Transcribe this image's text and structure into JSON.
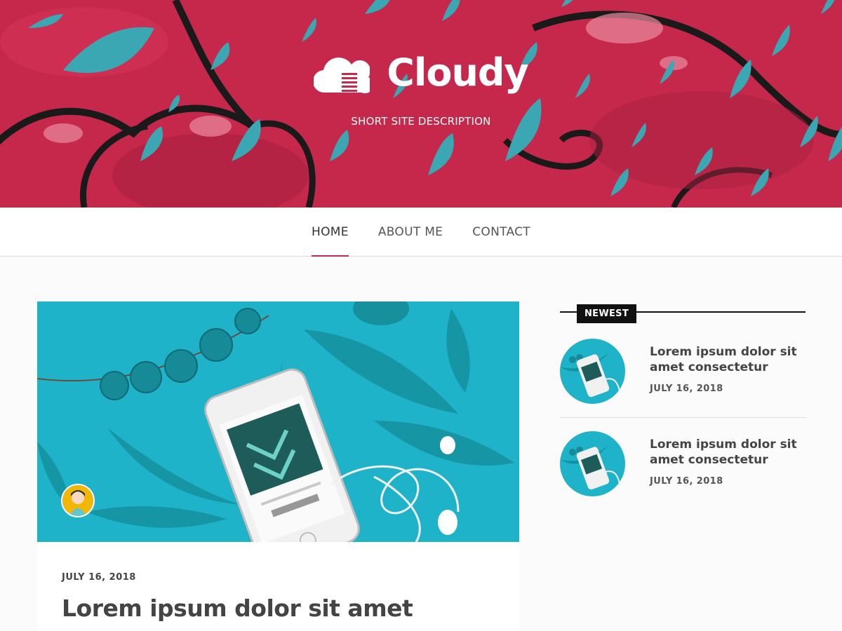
{
  "site": {
    "title": "Cloudy",
    "tagline": "SHORT SITE DESCRIPTION"
  },
  "nav": {
    "items": [
      {
        "label": "HOME",
        "active": true
      },
      {
        "label": "ABOUT ME",
        "active": false
      },
      {
        "label": "CONTACT",
        "active": false
      }
    ]
  },
  "post": {
    "date": "JULY 16, 2018",
    "title": "Lorem ipsum dolor sit amet"
  },
  "sidebar": {
    "widget_title": "NEWEST",
    "items": [
      {
        "title": "Lorem ipsum dolor sit amet consectetur",
        "date": "JULY 16, 2018"
      },
      {
        "title": "Lorem ipsum dolor sit amet consectetur",
        "date": "JULY 16, 2018"
      }
    ]
  },
  "colors": {
    "accent": "#c8284a",
    "hero_red": "#c8284a",
    "teal": "#1fb3c9",
    "dark": "#111111"
  },
  "icons": [
    "cloud-logo-icon"
  ]
}
